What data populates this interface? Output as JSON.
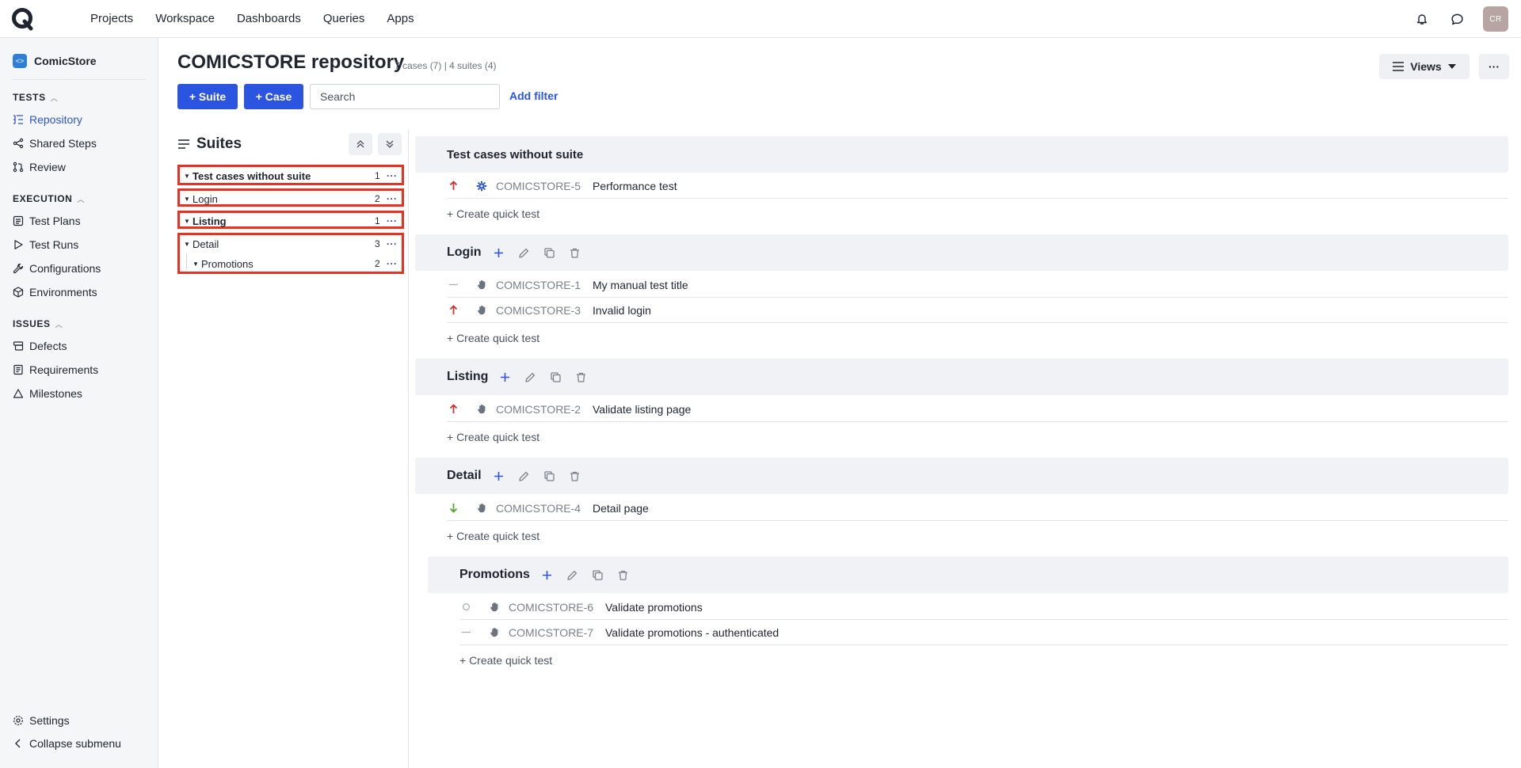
{
  "topnav": [
    "Projects",
    "Workspace",
    "Dashboards",
    "Queries",
    "Apps"
  ],
  "avatar_initials": "CR",
  "project": {
    "badge": "<>",
    "name": "ComicStore"
  },
  "sidebar": {
    "tests_label": "TESTS",
    "tests": [
      "Repository",
      "Shared Steps",
      "Review"
    ],
    "execution_label": "EXECUTION",
    "execution": [
      "Test Plans",
      "Test Runs",
      "Configurations",
      "Environments"
    ],
    "issues_label": "ISSUES",
    "issues": [
      "Defects",
      "Requirements",
      "Milestones"
    ],
    "settings": "Settings",
    "collapse": "Collapse submenu"
  },
  "header": {
    "title": "COMICSTORE repository",
    "meta": "7 cases (7) | 4 suites (4)",
    "views": "Views",
    "more": "···"
  },
  "toolbar": {
    "suite_btn": "+ Suite",
    "case_btn": "+ Case",
    "search_placeholder": "Search",
    "add_filter": "Add filter"
  },
  "suites_panel": {
    "title": "Suites",
    "tree": [
      {
        "label": "Test cases without suite",
        "count": "1"
      },
      {
        "label": "Login",
        "count": "2"
      },
      {
        "label": "Listing",
        "count": "1"
      },
      {
        "label": "Detail",
        "count": "3"
      },
      {
        "label": "Promotions",
        "count": "2"
      }
    ]
  },
  "sections": [
    {
      "title": "Test cases without suite",
      "cases": [
        {
          "priority": "high",
          "type": "automated",
          "id": "COMICSTORE-5",
          "title": "Performance test"
        }
      ]
    },
    {
      "title": "Login",
      "cases": [
        {
          "priority": "none",
          "type": "manual",
          "id": "COMICSTORE-1",
          "title": "My manual test title"
        },
        {
          "priority": "high",
          "type": "manual",
          "id": "COMICSTORE-3",
          "title": "Invalid login"
        }
      ]
    },
    {
      "title": "Listing",
      "cases": [
        {
          "priority": "high",
          "type": "manual",
          "id": "COMICSTORE-2",
          "title": "Validate listing page"
        }
      ]
    },
    {
      "title": "Detail",
      "cases": [
        {
          "priority": "low",
          "type": "manual",
          "id": "COMICSTORE-4",
          "title": "Detail page"
        }
      ]
    },
    {
      "title": "Promotions",
      "cases": [
        {
          "priority": "medium",
          "type": "manual",
          "id": "COMICSTORE-6",
          "title": "Validate promotions"
        },
        {
          "priority": "none",
          "type": "manual",
          "id": "COMICSTORE-7",
          "title": "Validate promotions - authenticated"
        }
      ]
    }
  ],
  "quick_test": "+ Create quick test",
  "colors": {
    "accent": "#2b55e0",
    "highlight": "#e53222",
    "high_priority": "#d0312d",
    "low_priority": "#54a630"
  }
}
